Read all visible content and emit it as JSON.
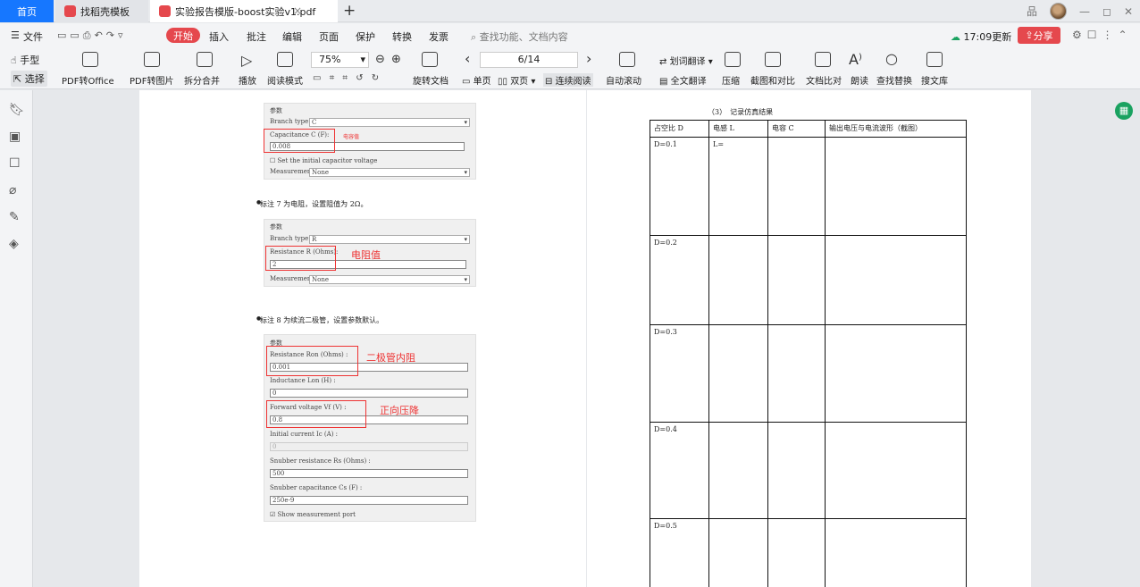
{
  "tabs": {
    "home": "首页",
    "template": "找稻壳模板",
    "document": "实验报告模版-boost实验v1.pdf",
    "close": "×",
    "add": "+"
  },
  "window": {
    "controls": [
      "品",
      "—",
      "◻",
      "✕"
    ]
  },
  "menu": {
    "items": [
      "文件",
      "开始",
      "插入",
      "批注",
      "编辑",
      "页面",
      "保护",
      "转换",
      "发票"
    ],
    "start": "开始",
    "search_placeholder": "查找功能、文档内容",
    "update_time": "17:09更新",
    "share": "分享"
  },
  "toolbar": {
    "hand": "手型",
    "select": "选择",
    "pdf_to_office": "PDF转Office",
    "pdf_to_image": "PDF转图片",
    "split_merge": "拆分合并",
    "play": "播放",
    "read_mode": "阅读模式",
    "zoom": "75%",
    "rotate": "旋转文档",
    "single_page": "单页",
    "double_page": "双页",
    "continuous": "连续阅读",
    "page": "6/14",
    "auto_scroll": "自动滚动",
    "word_translate": "划词翻译",
    "full_translate": "全文翻译",
    "compress": "压缩",
    "screenshot_compare": "截图和对比",
    "doc_compare": "文档比对",
    "read_aloud": "朗读",
    "find_replace": "查找替换",
    "library": "搜文库"
  },
  "doc": {
    "panel1": {
      "title": "参数",
      "branch_label": "Branch type:",
      "branch_value": "C",
      "cap_label": "Capacitance C (F):",
      "cap_note": "电容值",
      "cap_value": "0.008",
      "checkbox_label": "Set the initial capacitor voltage",
      "meas_label": "Measurements",
      "meas_value": "None"
    },
    "bullet1": "标注 7 为电阻，设置阻值为 2Ω。",
    "panel2": {
      "title": "参数",
      "branch_label": "Branch type:",
      "branch_value": "R",
      "res_label": "Resistance R (Ohms):",
      "res_note": "电阻值",
      "res_value": "2",
      "meas_label": "Measurements",
      "meas_value": "None"
    },
    "bullet2": "标注 8 为续流二极管，设置参数默认。",
    "panel3": {
      "title": "参数",
      "ron_label": "Resistance Ron (Ohms) :",
      "ron_note": "二极管内阻",
      "ron_value": "0.001",
      "lon_label": "Inductance Lon (H) :",
      "lon_value": "0",
      "vf_label": "Forward voltage Vf (V) :",
      "vf_note": "正向压降",
      "vf_value": "0.8",
      "ic_label": "Initial current Ic (A) :",
      "ic_value": "0",
      "rs_label": "Snubber resistance Rs (Ohms) :",
      "rs_value": "500",
      "cs_label": "Snubber capacitance Cs (F) :",
      "cs_value": "250e-9",
      "show_port": "Show measurement port"
    },
    "results_title": "（3）　记录仿真结果",
    "table_headers": [
      "占空比 D",
      "电感 L",
      "电容 C",
      "输出电压与电流波形（截图）"
    ],
    "table_rows": [
      {
        "d": "D=0.1",
        "l": "L="
      },
      {
        "d": "D=0.2",
        "l": ""
      },
      {
        "d": "D=0.3",
        "l": ""
      },
      {
        "d": "D=0.4",
        "l": ""
      },
      {
        "d": "D=0.5",
        "l": ""
      }
    ]
  }
}
